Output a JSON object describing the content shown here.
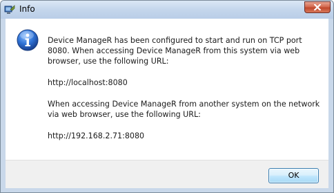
{
  "window": {
    "title": "Info",
    "app_icon": "device-manager-icon",
    "close_icon": "close-icon"
  },
  "dialog": {
    "icon": "info-icon",
    "line1": "Device ManageR has been configured to start and run on TCP port",
    "line2": "8080. When accessing Device ManageR from this system via web",
    "line3": "browser, use the following URL:",
    "local_url": "http://localhost:8080",
    "line4": "When accessing Device ManageR from another system on the network",
    "line5": "via web browser, use the following URL:",
    "network_url": "http://192.168.2.71:8080"
  },
  "buttons": {
    "ok_label": "OK"
  },
  "colors": {
    "title_bar": "#c4d6ec",
    "close_button": "#c0482d",
    "info_icon": "#1f5fc0",
    "ok_button_border": "#3c7fb1"
  }
}
